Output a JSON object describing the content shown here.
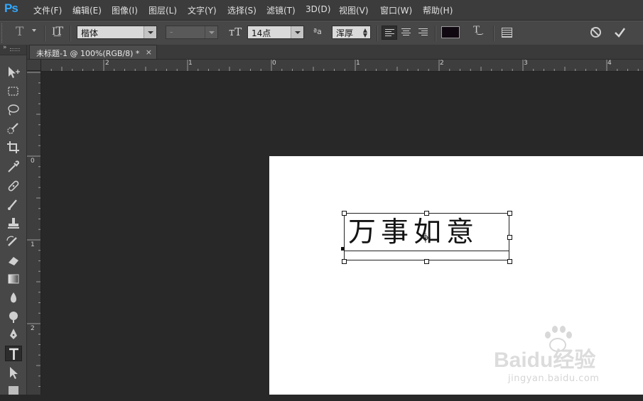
{
  "app": {
    "logo": "Ps"
  },
  "menu": [
    "文件(F)",
    "编辑(E)",
    "图像(I)",
    "图层(L)",
    "文字(Y)",
    "选择(S)",
    "滤镜(T)",
    "3D(D)",
    "视图(V)",
    "窗口(W)",
    "帮助(H)"
  ],
  "options": {
    "font_family": "楷体",
    "font_style": "-",
    "font_size": "14点",
    "antialias_label": "ªa",
    "antialias": "浑厚",
    "text_color": "#100810"
  },
  "document": {
    "tab_title": "未标题-1 @ 100%(RGB/8) *",
    "close_glyph": "×",
    "text": "万事如意",
    "page_color": "#ffffff"
  },
  "rulers": {
    "top": [
      "2",
      "1",
      "0",
      "1",
      "2",
      "3",
      "4"
    ],
    "left": [
      "0",
      "1",
      "2"
    ]
  },
  "watermark": {
    "brand": "Baidu经验",
    "url": "jingyan.baidu.com"
  }
}
